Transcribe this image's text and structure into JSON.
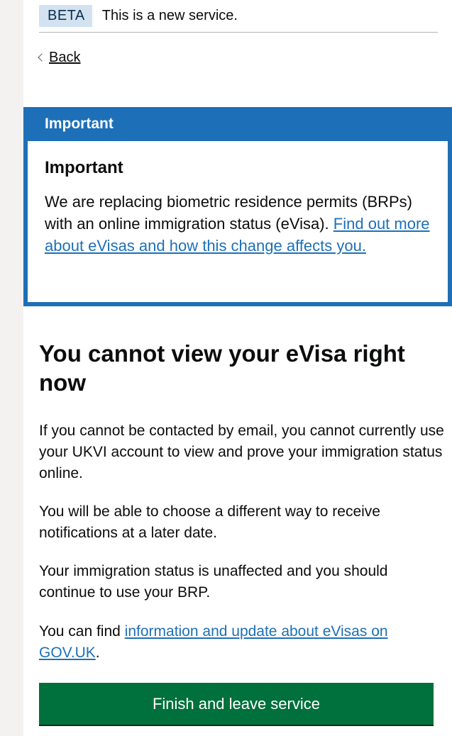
{
  "phase_banner": {
    "tag": "BETA",
    "text": "This is a new service."
  },
  "back_link": "Back",
  "notice": {
    "header": "Important",
    "title": "Important",
    "text": "We are replacing biometric residence permits (BRPs) with an online immigration status (eVisa).",
    "link": "Find out more about eVisas and how this change affects you."
  },
  "main": {
    "heading": "You cannot view your eVisa right now",
    "paragraphs": [
      "If you cannot be contacted by email, you cannot currently use your UKVI account to view and prove your immigration status online.",
      "You will be able to choose a different way to receive notifications at a later date.",
      "Your immigration status is unaffected and you should continue to use your BRP."
    ],
    "last_paragraph_prefix": "You can find",
    "last_paragraph_link": "information and update about eVisas on GOV.UK",
    "last_paragraph_suffix": "."
  },
  "button": {
    "label": "Finish and leave service"
  },
  "colors": {
    "brand_blue": "#1d70b8",
    "button_green": "#00703c",
    "tag_blue": "#d2e2f1"
  }
}
